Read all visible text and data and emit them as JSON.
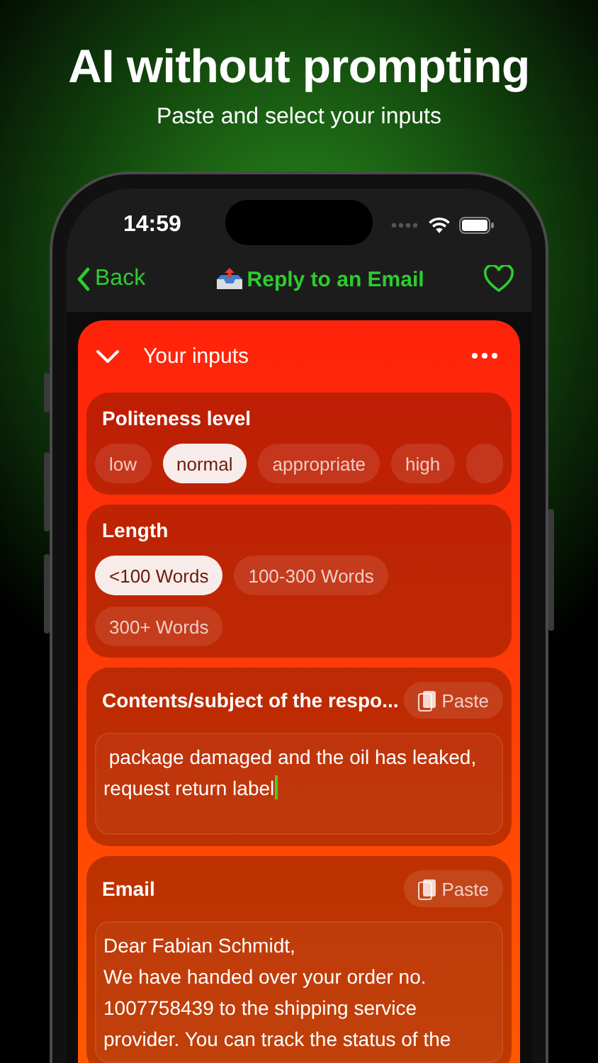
{
  "headline": "AI without prompting",
  "subheadline": "Paste and select your inputs",
  "status_bar": {
    "time": "14:59"
  },
  "nav": {
    "back": "Back",
    "title": "Reply to an Email",
    "favorite": false
  },
  "panel": {
    "title": "Your inputs",
    "expanded": true,
    "sections": [
      {
        "kind": "choice",
        "label": "Politeness level",
        "options": [
          {
            "label": "low",
            "selected": false
          },
          {
            "label": "normal",
            "selected": true
          },
          {
            "label": "appropriate",
            "selected": false
          },
          {
            "label": "high",
            "selected": false
          }
        ],
        "more": true
      },
      {
        "kind": "choice",
        "label": "Length",
        "options": [
          {
            "label": "<100 Words",
            "selected": true
          },
          {
            "label": "100-300 Words",
            "selected": false
          },
          {
            "label": "300+ Words",
            "selected": false
          }
        ],
        "more": false
      },
      {
        "kind": "text",
        "label": "Contents/subject of the respo...",
        "paste": "Paste",
        "value": " package damaged and the oil has leaked, request return label",
        "focused": true
      },
      {
        "kind": "text",
        "label": "Email",
        "paste": "Paste",
        "value": "Dear Fabian Schmidt,\nWe have handed over your order no. 1007758439 to the shipping service provider. You can track the status of the",
        "focused": false
      }
    ]
  }
}
